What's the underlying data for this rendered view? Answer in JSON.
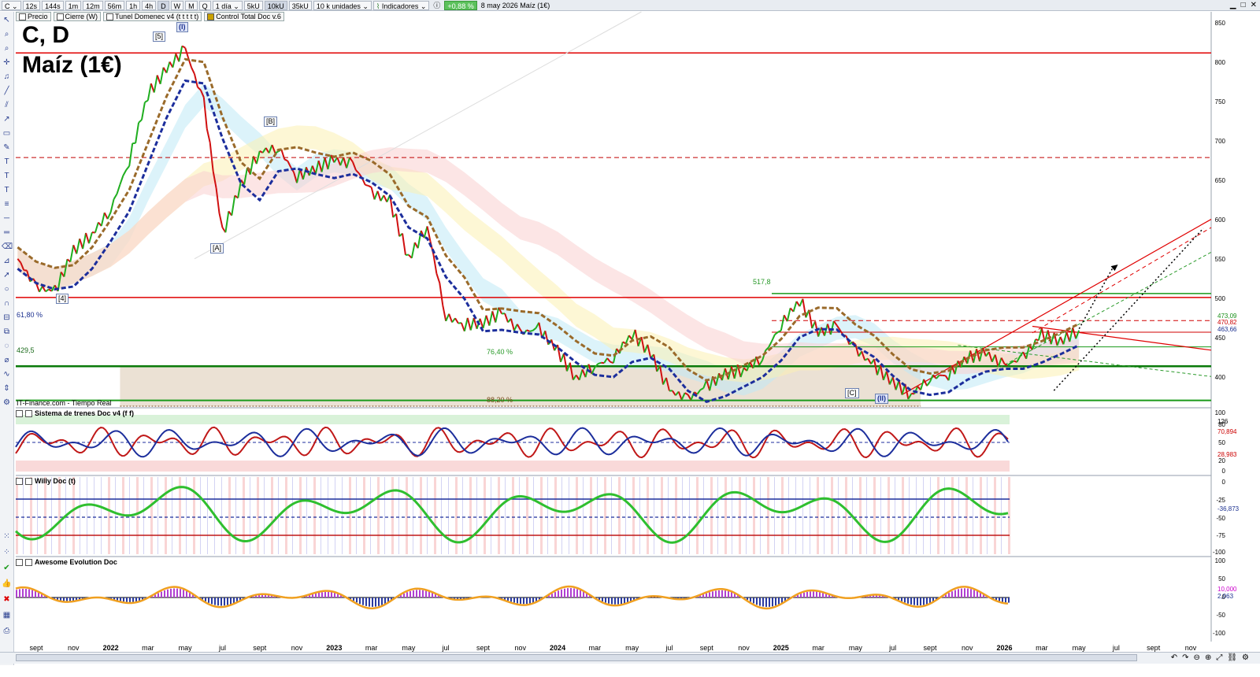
{
  "toolbar": {
    "symbol": "C",
    "timeframes": [
      "12s",
      "144s",
      "1m",
      "12m",
      "56m",
      "1h",
      "4h",
      "D",
      "W",
      "M",
      "Q"
    ],
    "period": "1 día",
    "units": [
      "5kU",
      "10kU",
      "35kU"
    ],
    "unit_select": "10 k unidades",
    "indicators_label": "Indicadores",
    "change": "+0,88 %",
    "date_name": "8 may 2026  Maíz (1€)"
  },
  "legend": [
    "Precio",
    "Cierre (W)",
    "Tunel Domenec v4 (t t t t t)",
    "Control Total Doc v.6"
  ],
  "title": {
    "line1": "C, D",
    "line2": "Maíz (1€)"
  },
  "source_label": "IT-Finance.com - Tiempo Real",
  "waves": [
    {
      "label": "[5]",
      "x": "2022-05"
    },
    {
      "label": "(I)",
      "x": "2022-05"
    },
    {
      "label": "[B]",
      "x": "2022-10"
    },
    {
      "label": "[A]",
      "x": "2022-07"
    },
    {
      "label": "[4]",
      "x": "2021-10"
    },
    {
      "label": "[C]",
      "x": "2025-08"
    },
    {
      "label": "(II)",
      "x": "2025-08"
    }
  ],
  "annotations": {
    "fib_61": "61,80 %",
    "level_429": "429,5",
    "fib_76": "76,40 %",
    "fib_88": "88,20 %",
    "high_517": "517,8"
  },
  "price_axis": {
    "ticks": [
      "850",
      "800",
      "750",
      "700",
      "650",
      "600",
      "550",
      "500",
      "450",
      "400"
    ],
    "tags": [
      {
        "text": "473,09",
        "color": "#1a8f1a"
      },
      {
        "text": "470,82",
        "color": "#cc0000"
      },
      {
        "text": "463,66",
        "color": "#1a2f8f"
      }
    ]
  },
  "panes": {
    "trains": {
      "title": "Sistema de trenes Doc v4 (f f)",
      "ticks": [
        "100",
        "80",
        "50",
        "20",
        "0"
      ],
      "tags": [
        "126",
        "70,894",
        "28,983"
      ]
    },
    "willy": {
      "title": "Willy Doc (t)",
      "ticks": [
        "0",
        "-25",
        "-50",
        "-75",
        "-100"
      ],
      "tags": [
        "-36,873"
      ]
    },
    "awesome": {
      "title": "Awesome Evolution Doc",
      "ticks": [
        "100",
        "50",
        "0",
        "-50",
        "-100"
      ],
      "tags": [
        "10,000",
        "2,063"
      ]
    }
  },
  "date_axis": [
    "sept",
    "nov",
    "2022",
    "mar",
    "may",
    "jul",
    "sept",
    "nov",
    "2023",
    "mar",
    "may",
    "jul",
    "sept",
    "nov",
    "2024",
    "mar",
    "may",
    "jul",
    "sept",
    "nov",
    "2025",
    "mar",
    "may",
    "jul",
    "sept",
    "nov",
    "2026",
    "mar",
    "may",
    "jul",
    "sept",
    "nov"
  ],
  "chart_data": {
    "type": "line",
    "title": "Maíz (1€)",
    "ylim": [
      380,
      860
    ],
    "series": [
      {
        "values": [
          [
            "2021-08",
            560
          ],
          [
            "2021-09",
            525
          ],
          [
            "2021-10",
            520
          ],
          [
            "2021-11",
            570
          ],
          [
            "2021-12",
            590
          ],
          [
            "2022-01",
            620
          ],
          [
            "2022-02",
            680
          ],
          [
            "2022-03",
            760
          ],
          [
            "2022-04",
            790
          ],
          [
            "2022-05",
            815
          ],
          [
            "2022-06",
            750
          ],
          [
            "2022-07",
            590
          ],
          [
            "2022-08",
            650
          ],
          [
            "2022-09",
            690
          ],
          [
            "2022-10",
            695
          ],
          [
            "2022-11",
            660
          ],
          [
            "2022-12",
            670
          ],
          [
            "2023-01",
            680
          ],
          [
            "2023-02",
            675
          ],
          [
            "2023-03",
            640
          ],
          [
            "2023-04",
            630
          ],
          [
            "2023-05",
            560
          ],
          [
            "2023-06",
            600
          ],
          [
            "2023-07",
            490
          ],
          [
            "2023-08",
            480
          ],
          [
            "2023-09",
            482
          ],
          [
            "2023-10",
            495
          ],
          [
            "2023-11",
            470
          ],
          [
            "2023-12",
            475
          ],
          [
            "2024-01",
            448
          ],
          [
            "2024-02",
            415
          ],
          [
            "2024-03",
            430
          ],
          [
            "2024-04",
            440
          ],
          [
            "2024-05",
            470
          ],
          [
            "2024-06",
            445
          ],
          [
            "2024-07",
            400
          ],
          [
            "2024-08",
            390
          ],
          [
            "2024-09",
            405
          ],
          [
            "2024-10",
            420
          ],
          [
            "2024-11",
            425
          ],
          [
            "2024-12",
            440
          ],
          [
            "2025-01",
            480
          ],
          [
            "2025-02",
            510
          ],
          [
            "2025-03",
            470
          ],
          [
            "2025-04",
            478
          ],
          [
            "2025-05",
            450
          ],
          [
            "2025-06",
            430
          ],
          [
            "2025-07",
            410
          ],
          [
            "2025-08",
            395
          ],
          [
            "2025-09",
            415
          ],
          [
            "2025-10",
            420
          ],
          [
            "2025-11",
            440
          ],
          [
            "2025-12",
            445
          ],
          [
            "2026-01",
            430
          ],
          [
            "2026-02",
            440
          ],
          [
            "2026-03",
            468
          ],
          [
            "2026-04",
            460
          ],
          [
            "2026-05",
            473
          ]
        ]
      }
    ],
    "levels": [
      810,
      683,
      513,
      517.8,
      473,
      470.8,
      429.5,
      388
    ],
    "fibonacci": {
      "61,80 %": 500,
      "76,40 %": 429.5,
      "88,20 %": 381
    },
    "x_range": [
      "2021-08",
      "2026-12"
    ]
  }
}
